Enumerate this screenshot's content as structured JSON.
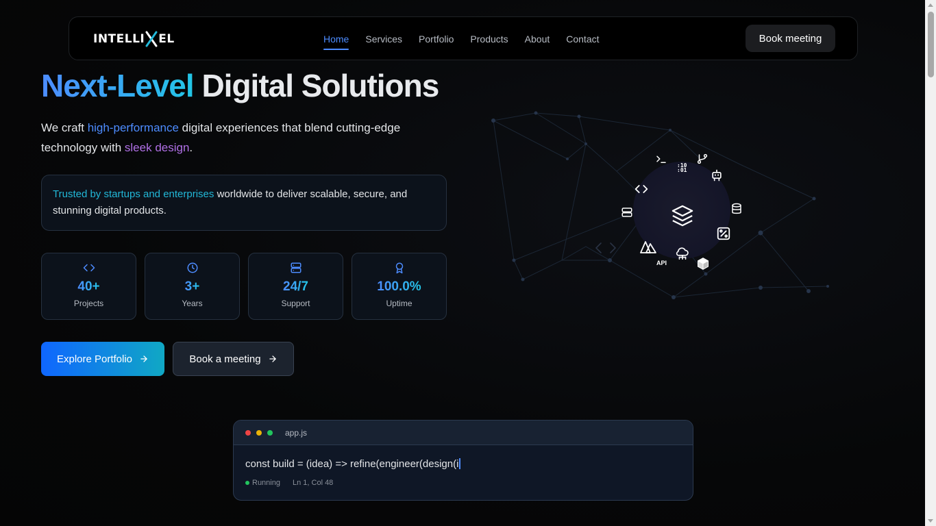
{
  "nav": {
    "logo_left": "INTELLI",
    "logo_right": "EL",
    "links": [
      "Home",
      "Services",
      "Portfolio",
      "Products",
      "About",
      "Contact"
    ],
    "active_link": "Home",
    "cta": "Book meeting"
  },
  "hero": {
    "title_grad": "Next-Level",
    "title_plain": "Digital Solutions",
    "sub_1": "We craft ",
    "sub_hl1": "high-performance",
    "sub_2": " digital experiences that blend cutting-edge technology with ",
    "sub_hl2": "sleek design",
    "sub_3": ".",
    "trust_hl": "Trusted by startups and enterprises",
    "trust_rest": " worldwide to deliver scalable, secure, and stunning digital products."
  },
  "stats": [
    {
      "icon": "code-icon",
      "value": "40+",
      "label": "Projects"
    },
    {
      "icon": "clock-icon",
      "value": "3+",
      "label": "Years"
    },
    {
      "icon": "server-icon",
      "value": "24/7",
      "label": "Support"
    },
    {
      "icon": "award-icon",
      "value": "100.0%",
      "label": "Uptime"
    }
  ],
  "buttons": {
    "primary": "Explore Portfolio",
    "secondary": "Book a meeting"
  },
  "orbit": {
    "binary_text": ":10\n:01",
    "api_text": "API"
  },
  "code": {
    "filename": "app.js",
    "line": "const build = (idea) => refine(engineer(design(i",
    "status": "Running",
    "position": "Ln 1, Col 48"
  },
  "colors": {
    "accent_blue": "#4d8cff",
    "accent_cyan": "#22c6e6",
    "accent_purple": "#b070e6",
    "status_green": "#22c55e"
  }
}
